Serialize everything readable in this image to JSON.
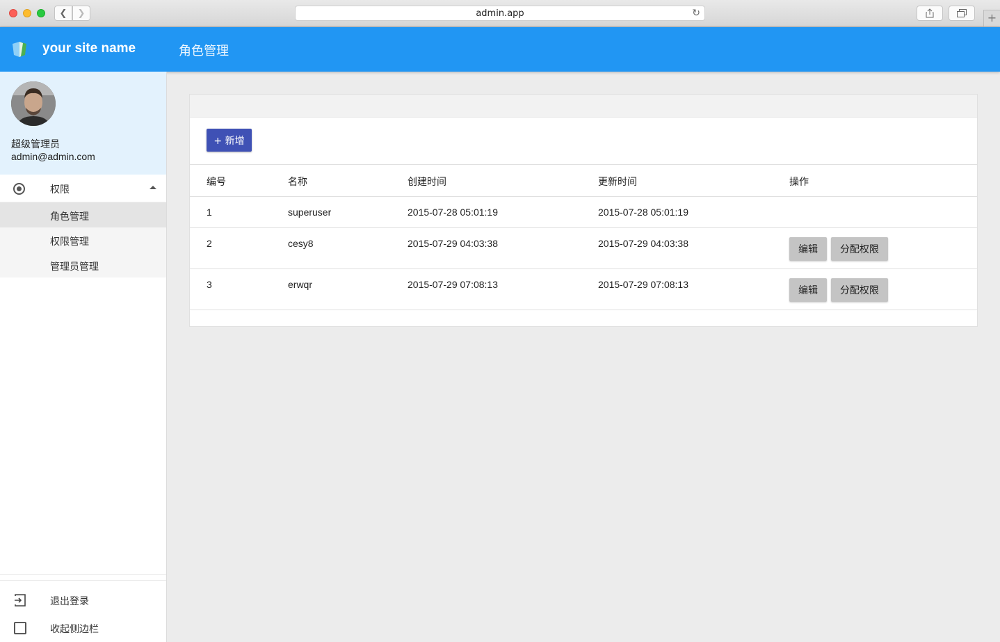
{
  "browser": {
    "url": "admin.app"
  },
  "header": {
    "site_name": "your site name",
    "page_title": "角色管理"
  },
  "sidebar": {
    "user": {
      "name": "超级管理员",
      "email": "admin@admin.com"
    },
    "group": {
      "label": "权限",
      "icon": "radio-icon",
      "expanded": true
    },
    "items": [
      {
        "label": "角色管理",
        "active": true
      },
      {
        "label": "权限管理",
        "active": false
      },
      {
        "label": "管理员管理",
        "active": false
      }
    ],
    "bottom": {
      "logout_label": "退出登录",
      "collapse_label": "收起侧边栏"
    }
  },
  "main": {
    "add_button_label": "+ 新增",
    "columns": [
      "编号",
      "名称",
      "创建时间",
      "更新时间",
      "操作"
    ],
    "rows": [
      {
        "id": "1",
        "name": "superuser",
        "created": "2015-07-28 05:01:19",
        "updated": "2015-07-28 05:01:19"
      },
      {
        "id": "2",
        "name": "cesy8",
        "created": "2015-07-29 04:03:38",
        "updated": "2015-07-29 04:03:38"
      },
      {
        "id": "3",
        "name": "erwqr",
        "created": "2015-07-29 07:08:13",
        "updated": "2015-07-29 07:08:13"
      }
    ],
    "edit_label": "编辑",
    "assign_label": "分配权限"
  },
  "colors": {
    "appbar": "#2196f3",
    "profile_bg": "#e3f2fd",
    "primary_button": "#3f51b5",
    "action_button": "#c4c4c4"
  }
}
